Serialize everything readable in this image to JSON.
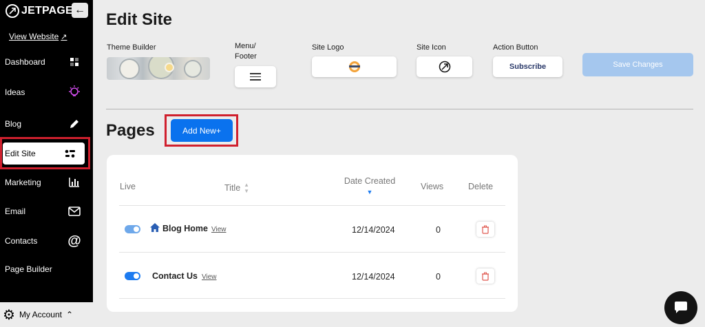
{
  "brand": {
    "name": "JETPAGE",
    "logo_icon": "jetpage-logo-icon",
    "collapse_icon": "arrow-left-icon"
  },
  "sidebar": {
    "view_website": "View Website",
    "items": [
      {
        "label": "Dashboard",
        "icon": "grid-icon"
      },
      {
        "label": "Ideas",
        "icon": "lightbulb-icon"
      },
      {
        "label": "Blog",
        "icon": "pencil-icon"
      },
      {
        "label": "Edit Site",
        "icon": "layout-icon",
        "active": true
      },
      {
        "label": "Marketing",
        "icon": "bar-chart-icon"
      },
      {
        "label": "Email",
        "icon": "envelope-icon"
      },
      {
        "label": "Contacts",
        "icon": "at-icon"
      },
      {
        "label": "Page Builder",
        "icon": ""
      }
    ],
    "account": "My Account"
  },
  "main": {
    "title": "Edit Site",
    "settings": {
      "theme_builder": "Theme Builder",
      "menu_footer": "Menu/ Footer",
      "site_logo": "Site Logo",
      "site_icon": "Site Icon",
      "action_button": "Action Button",
      "action_button_value": "Subscribe",
      "save": "Save Changes"
    },
    "pages_title": "Pages",
    "add_new": "Add New+",
    "table": {
      "headers": {
        "live": "Live",
        "title": "Title",
        "date_created": "Date Created",
        "views": "Views",
        "delete": "Delete"
      },
      "rows": [
        {
          "live": true,
          "title": "Blog Home",
          "view": "View",
          "date": "12/14/2024",
          "views": "0",
          "home": true
        },
        {
          "live": true,
          "title": "Contact Us",
          "view": "View",
          "date": "12/14/2024",
          "views": "0",
          "home": false
        }
      ]
    }
  },
  "colors": {
    "accent": "#0a72ee",
    "highlight": "#d0202e",
    "sidebar": "#000000",
    "save_disabled": "#a5c7ee"
  }
}
